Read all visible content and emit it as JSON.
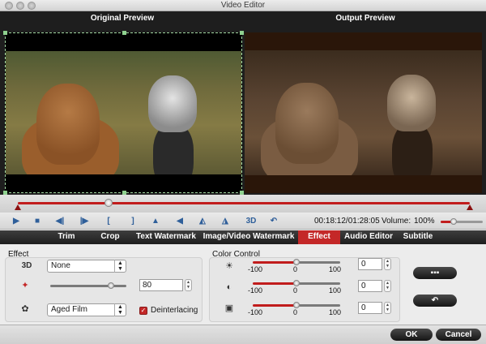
{
  "window": {
    "title": "Video Editor"
  },
  "preview": {
    "original_label": "Original Preview",
    "output_label": "Output Preview"
  },
  "player": {
    "current_time": "00:18:12",
    "total_time": "01:28:05",
    "time_display": "00:18:12/01:28:05",
    "volume_label": "Volume:",
    "volume_value": "100%",
    "volume_level": 0.3,
    "playhead_position": 0.2,
    "threed_label": "3D"
  },
  "tabs": [
    {
      "label": "Trim"
    },
    {
      "label": "Crop"
    },
    {
      "label": "Text Watermark"
    },
    {
      "label": "Image/Video Watermark"
    },
    {
      "label": "Effect",
      "active": true
    },
    {
      "label": "Audio Editor"
    },
    {
      "label": "Subtitle"
    }
  ],
  "effect": {
    "group_title": "Effect",
    "threed_icon_label": "3D",
    "threed_select_value": "None",
    "intensity_value": "80",
    "intensity_level": 0.8,
    "filter_select_value": "Aged Film",
    "deinterlacing_label": "Deinterlacing",
    "deinterlacing_checked": true
  },
  "color_control": {
    "group_title": "Color Control",
    "rows": [
      {
        "icon": "brightness-icon",
        "min_label": "-100",
        "mid_label": "0",
        "max_label": "100",
        "value": "0"
      },
      {
        "icon": "contrast-icon",
        "min_label": "-100",
        "mid_label": "0",
        "max_label": "100",
        "value": "0"
      },
      {
        "icon": "saturation-icon",
        "min_label": "-100",
        "mid_label": "0",
        "max_label": "100",
        "value": "0"
      }
    ]
  },
  "footer": {
    "ok_label": "OK",
    "cancel_label": "Cancel"
  },
  "colors": {
    "accent": "#c42828",
    "tab_bar": "#1d1d1d",
    "preview_bg": "#1e1e1e"
  }
}
